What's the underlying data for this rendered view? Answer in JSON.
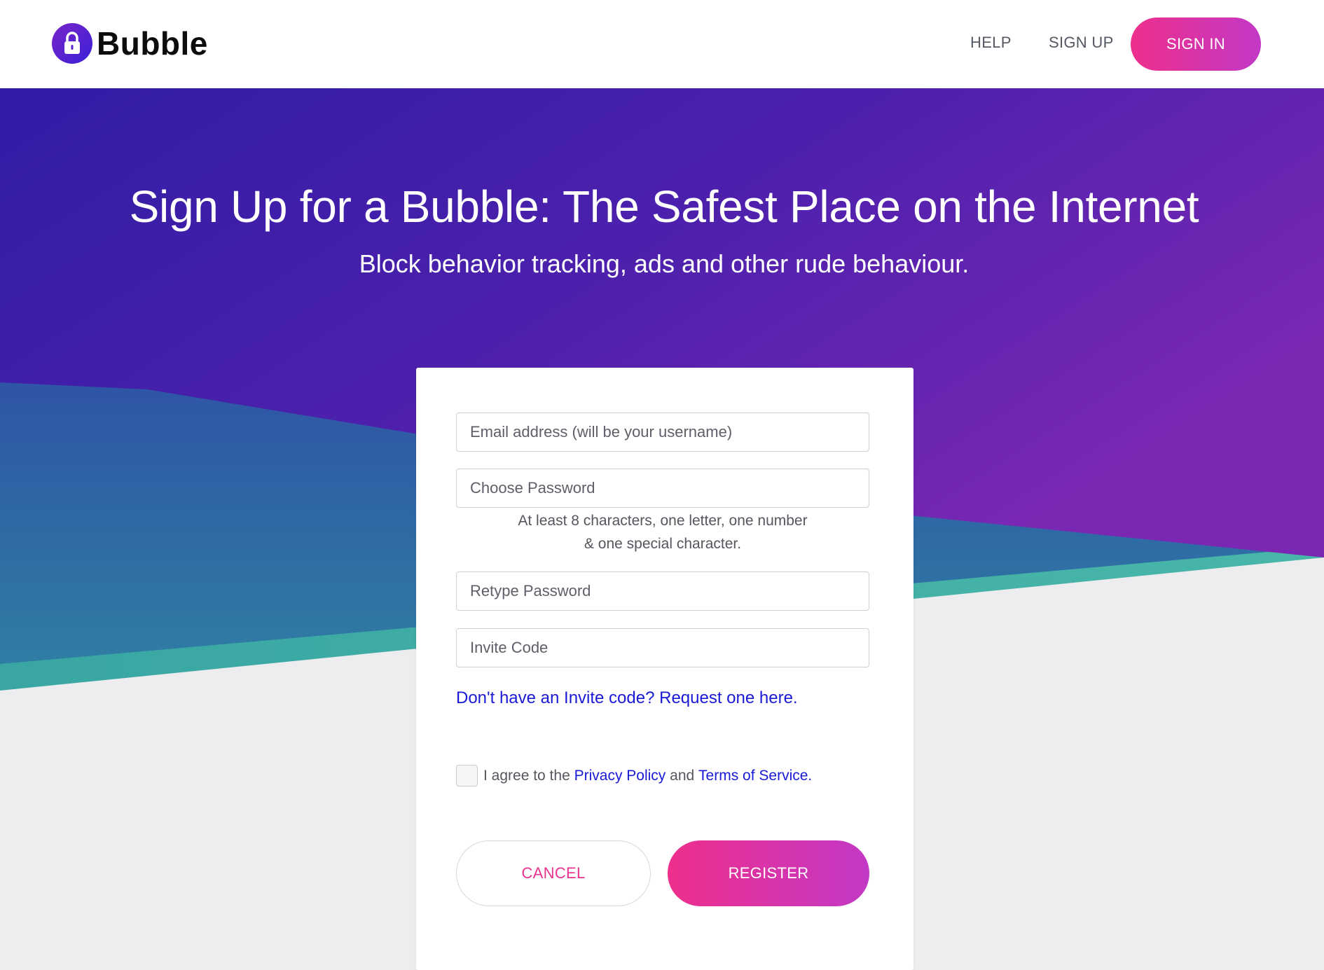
{
  "header": {
    "brand": "Bubble",
    "nav": {
      "help": "HELP",
      "sign_up": "SIGN UP",
      "sign_in": "SIGN IN"
    }
  },
  "hero": {
    "title": "Sign Up for a Bubble: The Safest Place on the Internet",
    "subtitle": "Block behavior tracking, ads and other rude behaviour."
  },
  "form": {
    "email_placeholder": "Email address (will be your username)",
    "password_placeholder": "Choose Password",
    "password_hint_line1": "At least 8 characters, one letter, one number",
    "password_hint_line2": "& one special character.",
    "retype_placeholder": "Retype Password",
    "invite_placeholder": "Invite Code",
    "invite_link": "Don't have an Invite code? Request one here.",
    "agree_prefix": "I agree to the",
    "privacy_policy": "Privacy Policy",
    "agree_and": "and",
    "terms_of_service": "Terms of Service",
    "agree_suffix": ".",
    "agreed": false,
    "cancel_label": "CANCEL",
    "register_label": "REGISTER"
  },
  "icons": {
    "logo": "lock-icon"
  },
  "colors": {
    "accent_start": "#ee2f8c",
    "accent_end": "#c238c5",
    "hero_purple": "#3b1ca8",
    "hero_violet": "#7a28b4",
    "teal": "#3aa9a6",
    "link": "#1a1ad6"
  }
}
